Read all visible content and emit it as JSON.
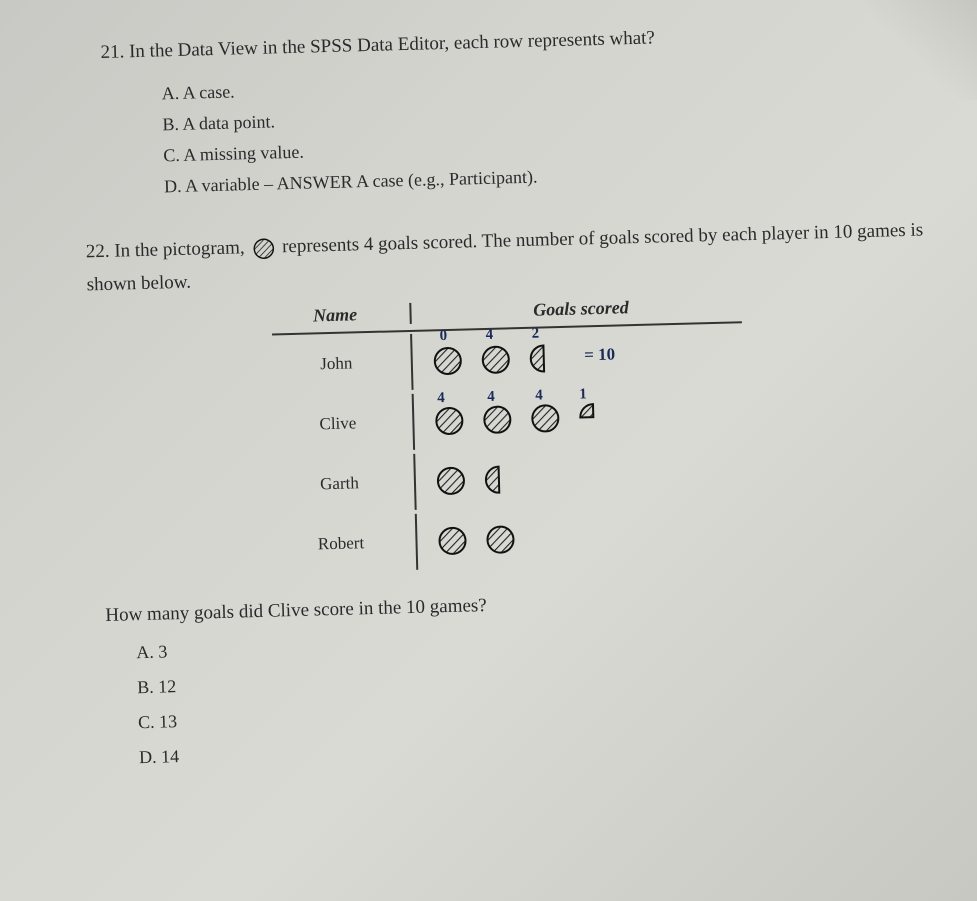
{
  "q21": {
    "number": "21.",
    "text": "In the Data View in the SPSS Data Editor, each row represents what?",
    "options": {
      "A": "A. A case.",
      "B": "B. A data point.",
      "C": "C. A missing value.",
      "D": "D. A variable – ANSWER A case (e.g., Participant)."
    }
  },
  "q22": {
    "number": "22.",
    "intro_part1": "In the pictogram,",
    "intro_part2": "represents 4 goals scored. The number of goals scored by each player in 10 games is shown below.",
    "table": {
      "header_name": "Name",
      "header_goals": "Goals scored",
      "rows": [
        {
          "name": "John"
        },
        {
          "name": "Clive"
        },
        {
          "name": "Garth"
        },
        {
          "name": "Robert"
        }
      ]
    },
    "annotations": {
      "john_0": "0",
      "john_1": "4",
      "john_2": "2",
      "john_tail": "= 10",
      "clive_0": "4",
      "clive_1": "4",
      "clive_2": "4",
      "clive_3": "1"
    },
    "question": "How many goals did Clive score in the 10 games?",
    "options": {
      "A": "A. 3",
      "B": "B. 12",
      "C": "C. 13",
      "D": "D. 14"
    }
  },
  "chart_data": {
    "type": "table",
    "title": "Pictogram: goals scored",
    "legend": "1 full ball = 4 goals",
    "columns": [
      "Name",
      "Goals scored (balls)"
    ],
    "rows": [
      {
        "name": "John",
        "full_balls": 2,
        "half_balls": 1,
        "quarter_balls": 0,
        "goals_equivalent": 10
      },
      {
        "name": "Clive",
        "full_balls": 3,
        "half_balls": 0,
        "quarter_balls": 1,
        "goals_equivalent": 13
      },
      {
        "name": "Garth",
        "full_balls": 1,
        "half_balls": 1,
        "quarter_balls": 0,
        "goals_equivalent": 6
      },
      {
        "name": "Robert",
        "full_balls": 2,
        "half_balls": 0,
        "quarter_balls": 0,
        "goals_equivalent": 8
      }
    ]
  }
}
